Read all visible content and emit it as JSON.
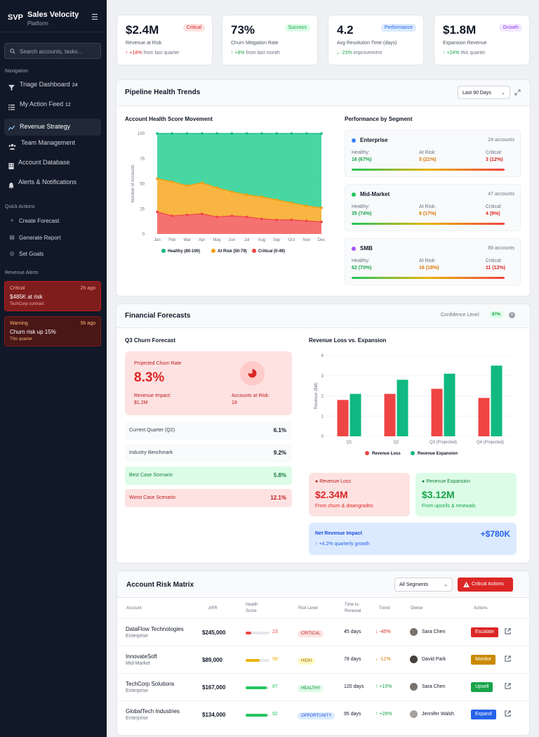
{
  "sidebar": {
    "logo": "SVP",
    "title": "Sales Velocity",
    "subtitle": "Platform",
    "search_placeholder": "Search accounts, tasks...",
    "nav_label": "Navigation",
    "nav": [
      {
        "label": "Triage Dashboard",
        "count": "24"
      },
      {
        "label": "My Action Feed",
        "count": "12"
      },
      {
        "label": "Revenue Strategy",
        "count": ""
      },
      {
        "label": "Team Management",
        "count": ""
      },
      {
        "label": "Account Database",
        "count": ""
      },
      {
        "label": "Alerts & Notifications",
        "count": ""
      }
    ],
    "quick_label": "Quick Actions",
    "quick": [
      "Create Forecast",
      "Generate Report",
      "Set Goals"
    ],
    "alerts_label": "Revenue Alerts",
    "alerts": [
      {
        "type": "Critical",
        "time": "2h ago",
        "msg": "$485K at risk",
        "sub": "TechCorp contract"
      },
      {
        "type": "Warning",
        "time": "5h ago",
        "msg": "Churn risk up 15%",
        "sub": "This quarter"
      }
    ]
  },
  "kpis": [
    {
      "value": "$2.4M",
      "badge": "Critical",
      "label": "Revenue at Risk",
      "arrow": "↑",
      "change": "+18%",
      "suffix": "from last quarter"
    },
    {
      "value": "73%",
      "badge": "Success",
      "label": "Churn Mitigation Rate",
      "arrow": "↑",
      "change": "+8%",
      "suffix": "from last month"
    },
    {
      "value": "4.2",
      "badge": "Performance",
      "label": "Avg Resolution Time (days)",
      "arrow": "↓",
      "change": "-23%",
      "suffix": "improvement"
    },
    {
      "value": "$1.8M",
      "badge": "Growth",
      "label": "Expansion Revenue",
      "arrow": "↑",
      "change": "+24%",
      "suffix": "this quarter"
    }
  ],
  "pipeline": {
    "title": "Pipeline Health Trends",
    "range": "Last 90 Days",
    "chart_title": "Account Health Score Movement",
    "seg_title": "Performance by Segment",
    "segments": [
      {
        "name": "Enterprise",
        "accounts": "24 accounts",
        "healthy": "16 (67%)",
        "at_risk": "5 (21%)",
        "critical": "3 (12%)",
        "color": "#3b82f6"
      },
      {
        "name": "Mid-Market",
        "accounts": "47 accounts",
        "healthy": "35 (74%)",
        "at_risk": "8 (17%)",
        "critical": "4 (9%)",
        "color": "#22c55e"
      },
      {
        "name": "SMB",
        "accounts": "89 accounts",
        "healthy": "62 (70%)",
        "at_risk": "16 (18%)",
        "critical": "11 (12%)",
        "color": "#a855f7"
      }
    ],
    "labels": {
      "healthy": "Healthy:",
      "at_risk": "At Risk:",
      "critical": "Critical:"
    }
  },
  "forecast": {
    "title": "Financial Forecasts",
    "confidence_label": "Confidence Level:",
    "confidence": "87%",
    "churn_title": "Q3 Churn Forecast",
    "projected_label": "Projected Churn Rate",
    "projected": "8.3%",
    "impact_label": "Revenue Impact:",
    "impact": "$1.2M",
    "accounts_label": "Accounts at Risk:",
    "accounts": "18",
    "rows": [
      {
        "label": "Current Quarter (Q2)",
        "value": "6.1%"
      },
      {
        "label": "Industry Benchmark",
        "value": "9.2%"
      },
      {
        "label": "Best Case Scenario",
        "value": "5.8%"
      },
      {
        "label": "Worst Case Scenario",
        "value": "12.1%"
      }
    ],
    "bar_title": "Revenue Loss vs. Expansion",
    "loss": {
      "label": "Revenue Loss",
      "value": "$2.34M",
      "sub": "From churn & downgrades"
    },
    "expansion": {
      "label": "Revenue Expansion",
      "value": "$3.12M",
      "sub": "From upsells & renewals"
    },
    "net": {
      "label": "Net Revenue Impact",
      "value": "+$780K",
      "sub": "↑ +4.2% quarterly growth"
    }
  },
  "chart_data": [
    {
      "type": "area",
      "title": "Account Health Score Movement",
      "ylabel": "Number of Accounts",
      "ylim": [
        0,
        100
      ],
      "categories": [
        "Jan",
        "Feb",
        "Mar",
        "Apr",
        "May",
        "Jun",
        "Jul",
        "Aug",
        "Sep",
        "Oct",
        "Nov",
        "Dec"
      ],
      "series": [
        {
          "name": "Healthy (80-100)",
          "color": "#10b981",
          "values": [
            100,
            100,
            100,
            100,
            100,
            100,
            100,
            100,
            100,
            100,
            100,
            100
          ]
        },
        {
          "name": "At Risk (50-79)",
          "color": "#f59e0b",
          "values": [
            55,
            52,
            48,
            51,
            46,
            42,
            39,
            37,
            34,
            31,
            28,
            26
          ]
        },
        {
          "name": "Critical (0-49)",
          "color": "#ef4444",
          "values": [
            22,
            18,
            19,
            20,
            17,
            18,
            17,
            15,
            14,
            14,
            13,
            12
          ]
        }
      ]
    },
    {
      "type": "bar",
      "title": "Revenue Loss vs. Expansion",
      "ylabel": "Revenue ($M)",
      "ylim": [
        0,
        4
      ],
      "categories": [
        "Q1",
        "Q2",
        "Q3 (Projected)",
        "Q4 (Projected)"
      ],
      "series": [
        {
          "name": "Revenue Loss",
          "color": "#ef4444",
          "values": [
            1.8,
            2.1,
            2.35,
            1.9
          ]
        },
        {
          "name": "Revenue Expansion",
          "color": "#10b981",
          "values": [
            2.1,
            2.8,
            3.1,
            3.5
          ]
        }
      ]
    }
  ],
  "matrix": {
    "title": "Account Risk Matrix",
    "filter": "All Segments",
    "critical_btn": "Critical Actions",
    "headers": {
      "account": "Account",
      "arr": "ARR",
      "health": "Health",
      "score": "Score",
      "risk": "Risk Level",
      "time": "Time to",
      "renewal": "Renewal",
      "trend": "Trend",
      "owner": "Owner",
      "actions": "Actions"
    },
    "rows": [
      {
        "name": "DataFlow Technologies",
        "segment": "Enterprise",
        "arr": "$245,000",
        "health": 23,
        "risk": "CRITICAL",
        "time": "45 days",
        "trend": "-45%",
        "dir": "↓",
        "owner": "Sara Chen",
        "action": "Escalate",
        "color": "#ef4444",
        "abg": "#dc2626",
        "rbg": "#fee2e2",
        "rc": "#b91c1c",
        "tc": "#dc2626"
      },
      {
        "name": "InnovateSoft",
        "segment": "Mid-Market",
        "arr": "$89,000",
        "health": 58,
        "risk": "HIGH",
        "time": "78 days",
        "trend": "-12%",
        "dir": "↓",
        "owner": "David Park",
        "action": "Monitor",
        "color": "#eab308",
        "abg": "#ca8a04",
        "rbg": "#fef9c3",
        "rc": "#a16207",
        "tc": "#d97706"
      },
      {
        "name": "TechCorp Solutions",
        "segment": "Enterprise",
        "arr": "$167,000",
        "health": 87,
        "risk": "HEALTHY",
        "time": "120 days",
        "trend": "+15%",
        "dir": "↑",
        "owner": "Sara Chen",
        "action": "Upsell",
        "color": "#22c55e",
        "abg": "#16a34a",
        "rbg": "#dcfce7",
        "rc": "#15803d",
        "tc": "#16a34a"
      },
      {
        "name": "GlobalTech Industries",
        "segment": "Enterprise",
        "arr": "$134,000",
        "health": 92,
        "risk": "OPPORTUNITY",
        "time": "95 days",
        "trend": "+28%",
        "dir": "↑",
        "owner": "Jennifer Walsh",
        "action": "Expand",
        "color": "#22c55e",
        "abg": "#2563eb",
        "rbg": "#dbeafe",
        "rc": "#1d4ed8",
        "tc": "#16a34a"
      }
    ]
  }
}
